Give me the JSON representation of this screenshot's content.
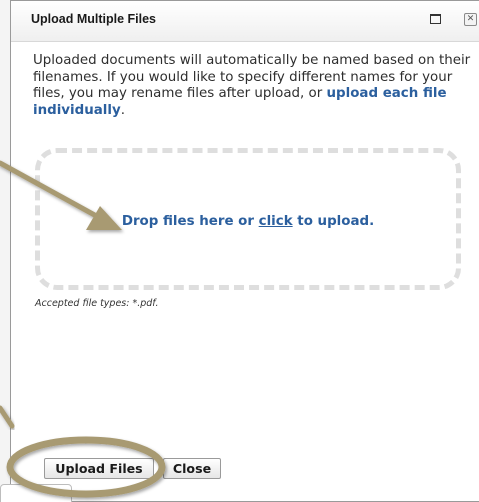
{
  "dialog": {
    "title": "Upload Multiple Files",
    "intro_text": "Uploaded documents will automatically be named based on their filenames. If you would like to specify different names for your files, you may rename files after upload, or ",
    "intro_link": "upload each file individually",
    "intro_end": "."
  },
  "dropzone": {
    "prefix": "Drop files here or ",
    "link": "click",
    "suffix": " to upload."
  },
  "accepted_types": "Accepted file types: *.pdf.",
  "buttons": {
    "upload": "Upload Files",
    "close": "Close"
  },
  "icons": {
    "maximize": "maximize-icon",
    "close": "close-icon"
  },
  "colors": {
    "link": "#2b5f9e",
    "annotation": "#a89a72"
  }
}
